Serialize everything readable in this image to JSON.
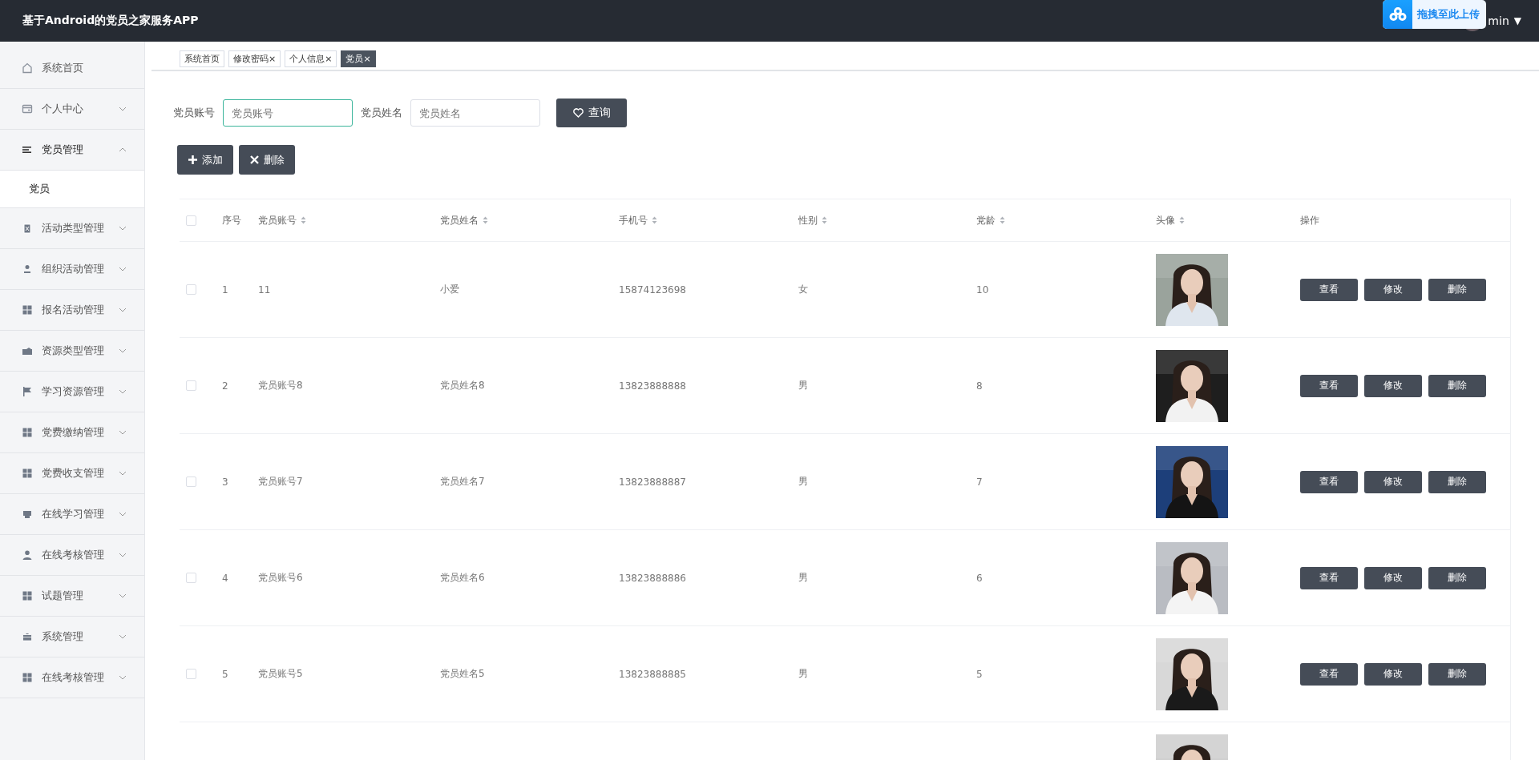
{
  "header": {
    "title": "基于Android的党员之家服务APP",
    "upload_popup": {
      "label": "拖拽至此上传"
    },
    "user": {
      "name": "min",
      "caret": "▼"
    }
  },
  "sidebar": {
    "items": [
      {
        "label": "系统首页",
        "kind": "link",
        "expanded": false
      },
      {
        "label": "个人中心",
        "kind": "menu",
        "expanded": false
      },
      {
        "label": "党员管理",
        "kind": "menu",
        "expanded": true,
        "children": [
          {
            "label": "党员",
            "selected": true
          }
        ]
      },
      {
        "label": "活动类型管理",
        "kind": "menu",
        "expanded": false
      },
      {
        "label": "组织活动管理",
        "kind": "menu",
        "expanded": false
      },
      {
        "label": "报名活动管理",
        "kind": "menu",
        "expanded": false
      },
      {
        "label": "资源类型管理",
        "kind": "menu",
        "expanded": false
      },
      {
        "label": "学习资源管理",
        "kind": "menu",
        "expanded": false
      },
      {
        "label": "党费缴纳管理",
        "kind": "menu",
        "expanded": false
      },
      {
        "label": "党费收支管理",
        "kind": "menu",
        "expanded": false
      },
      {
        "label": "在线学习管理",
        "kind": "menu",
        "expanded": false
      },
      {
        "label": "在线考核管理",
        "kind": "menu",
        "expanded": false
      },
      {
        "label": "试题管理",
        "kind": "menu",
        "expanded": false
      },
      {
        "label": "系统管理",
        "kind": "menu",
        "expanded": false
      },
      {
        "label": "在线考核管理",
        "kind": "menu",
        "expanded": false
      }
    ]
  },
  "tabs": [
    {
      "label": "系统首页",
      "selected": false
    },
    {
      "label": "修改密码",
      "close": "×",
      "selected": false
    },
    {
      "label": "个人信息",
      "close": "×",
      "selected": false
    },
    {
      "label": "党员",
      "close": "×",
      "selected": true
    }
  ],
  "search": {
    "fields": [
      {
        "label": "党员账号",
        "placeholder": "党员账号",
        "focused": true
      },
      {
        "label": "党员姓名",
        "placeholder": "党员姓名",
        "focused": false
      }
    ],
    "button": {
      "label": "查询"
    }
  },
  "actions": [
    {
      "label": "添加",
      "kind": "add"
    },
    {
      "label": "删除",
      "kind": "delete"
    }
  ],
  "table": {
    "header_checked": false,
    "columns": [
      {
        "label": "序号",
        "sortable": false
      },
      {
        "label": "党员账号",
        "sortable": true
      },
      {
        "label": "党员姓名",
        "sortable": true
      },
      {
        "label": "手机号",
        "sortable": true
      },
      {
        "label": "性别",
        "sortable": true
      },
      {
        "label": "党龄",
        "sortable": true
      },
      {
        "label": "头像",
        "sortable": true
      },
      {
        "label": "操作",
        "sortable": false
      }
    ],
    "rows": [
      {
        "checked": false,
        "index": "1",
        "account": "11",
        "name": "小爱",
        "phone": "15874123698",
        "gender": "女",
        "years": "10",
        "avatar": {
          "kind": "picture"
        },
        "actions": [
          "查看",
          "修改",
          "删除"
        ]
      },
      {
        "checked": false,
        "index": "2",
        "account": "党员账号8",
        "name": "党员姓名8",
        "phone": "13823888888",
        "gender": "男",
        "years": "8",
        "avatar": {
          "kind": "picture"
        },
        "actions": [
          "查看",
          "修改",
          "删除"
        ]
      },
      {
        "checked": false,
        "index": "3",
        "account": "党员账号7",
        "name": "党员姓名7",
        "phone": "13823888887",
        "gender": "男",
        "years": "7",
        "avatar": {
          "kind": "picture"
        },
        "actions": [
          "查看",
          "修改",
          "删除"
        ]
      },
      {
        "checked": false,
        "index": "4",
        "account": "党员账号6",
        "name": "党员姓名6",
        "phone": "13823888886",
        "gender": "男",
        "years": "6",
        "avatar": {
          "kind": "picture"
        },
        "actions": [
          "查看",
          "修改",
          "删除"
        ]
      },
      {
        "checked": false,
        "index": "5",
        "account": "党员账号5",
        "name": "党员姓名5",
        "phone": "13823888885",
        "gender": "男",
        "years": "5",
        "avatar": {
          "kind": "picture"
        },
        "actions": [
          "查看",
          "修改",
          "删除"
        ]
      },
      {
        "avatar": {
          "kind": "picture"
        }
      }
    ]
  }
}
